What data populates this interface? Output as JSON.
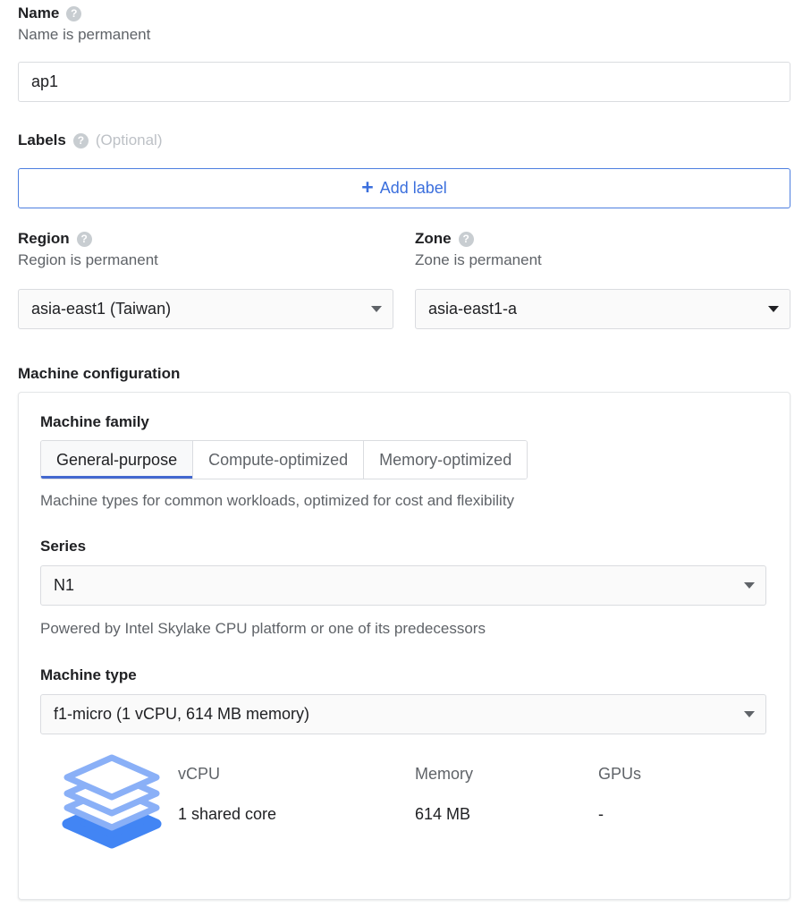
{
  "name_section": {
    "label": "Name",
    "help_icon": "help-circle-icon",
    "description": "Name is permanent",
    "value": "ap1",
    "placeholder": ""
  },
  "labels_section": {
    "label": "Labels",
    "help_icon": "help-circle-icon",
    "optional_text": "(Optional)",
    "add_button": {
      "plus": "+",
      "label": "Add label"
    }
  },
  "region_section": {
    "label": "Region",
    "help_icon": "help-circle-icon",
    "description": "Region is permanent",
    "selected": "asia-east1 (Taiwan)"
  },
  "zone_section": {
    "label": "Zone",
    "help_icon": "help-circle-icon",
    "description": "Zone is permanent",
    "selected": "asia-east1-a"
  },
  "machine_configuration": {
    "heading": "Machine configuration",
    "machine_family": {
      "heading": "Machine family",
      "tabs": [
        {
          "label": "General-purpose",
          "selected": true
        },
        {
          "label": "Compute-optimized",
          "selected": false
        },
        {
          "label": "Memory-optimized",
          "selected": false
        }
      ],
      "description": "Machine types for common workloads, optimized for cost and flexibility"
    },
    "series": {
      "heading": "Series",
      "selected": "N1",
      "description": "Powered by Intel Skylake CPU platform or one of its predecessors"
    },
    "machine_type": {
      "heading": "Machine type",
      "selected": "f1-micro (1 vCPU, 614 MB memory)"
    },
    "specs": {
      "icon": "stacked-layers-icon",
      "columns": [
        {
          "header": "vCPU",
          "value": "1 shared core"
        },
        {
          "header": "Memory",
          "value": "614 MB"
        },
        {
          "header": "GPUs",
          "value": "-"
        }
      ]
    }
  },
  "colors": {
    "accent_blue": "#4285f4",
    "link_blue": "#3b6fdd",
    "tab_underline": "#4267cf",
    "secondary_text": "#5f6368",
    "help_icon_gray": "#c8cdd1",
    "border_gray": "#dadce0"
  }
}
